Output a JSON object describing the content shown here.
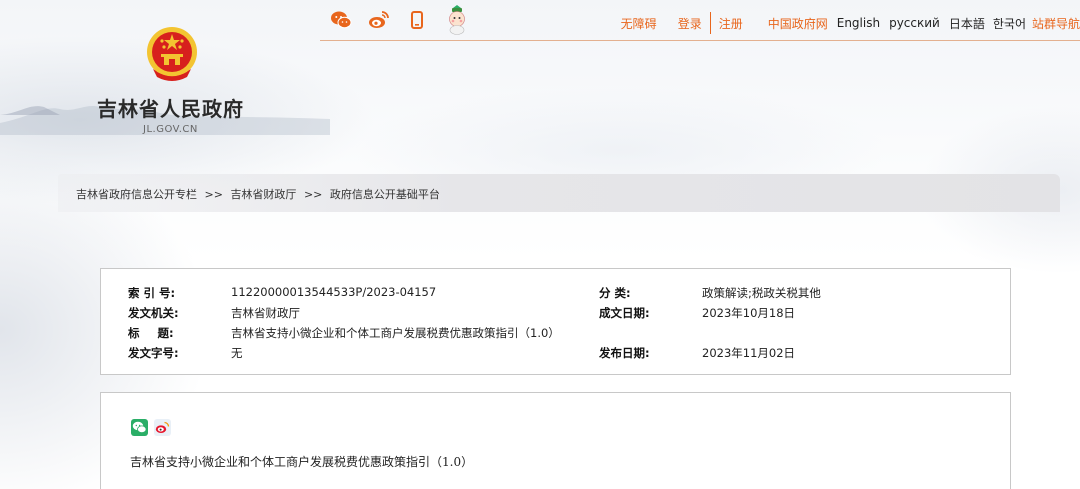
{
  "header": {
    "social": [
      {
        "name": "wechat-icon"
      },
      {
        "name": "weibo-icon"
      },
      {
        "name": "mobile-icon"
      },
      {
        "name": "mascot-icon"
      }
    ],
    "nav": {
      "accessible": "无障碍",
      "login": "登录",
      "register": "注册",
      "china_gov": "中国政府网",
      "english": "English",
      "russian": "русский",
      "japanese": "日本語",
      "korean": "한국어",
      "site_nav": "站群导航"
    },
    "site_title": "吉林省人民政府",
    "site_domain": "JL.GOV.CN"
  },
  "breadcrumb": {
    "items": [
      "吉林省政府信息公开专栏",
      "吉林省财政厅",
      "政府信息公开基础平台"
    ],
    "separator": ">>"
  },
  "meta": {
    "index_label": "索 引 号:",
    "index_value": "11220000013544533P/2023-04157",
    "category_label": "分 类:",
    "category_value": "政策解读;税政关税其他",
    "issuer_label": "发文机关:",
    "issuer_value": "吉林省财政厅",
    "created_label": "成文日期:",
    "created_value": "2023年10月18日",
    "title_label": "标 题:",
    "title_value": "吉林省支持小微企业和个体工商户发展税费优惠政策指引（1.0）",
    "docno_label": "发文字号:",
    "docno_value": "无",
    "published_label": "发布日期:",
    "published_value": "2023年11月02日"
  },
  "content": {
    "article_title": "吉林省支持小微企业和个体工商户发展税费优惠政策指引（1.0）",
    "share": [
      "wechat-share-icon",
      "weibo-share-icon"
    ]
  },
  "colors": {
    "accent": "#e8661d",
    "divider": "#e3b08f",
    "border": "#c8c8c8",
    "wechat_green": "#2aae67",
    "emblem_red": "#d7201d",
    "emblem_gold": "#f3c431"
  }
}
